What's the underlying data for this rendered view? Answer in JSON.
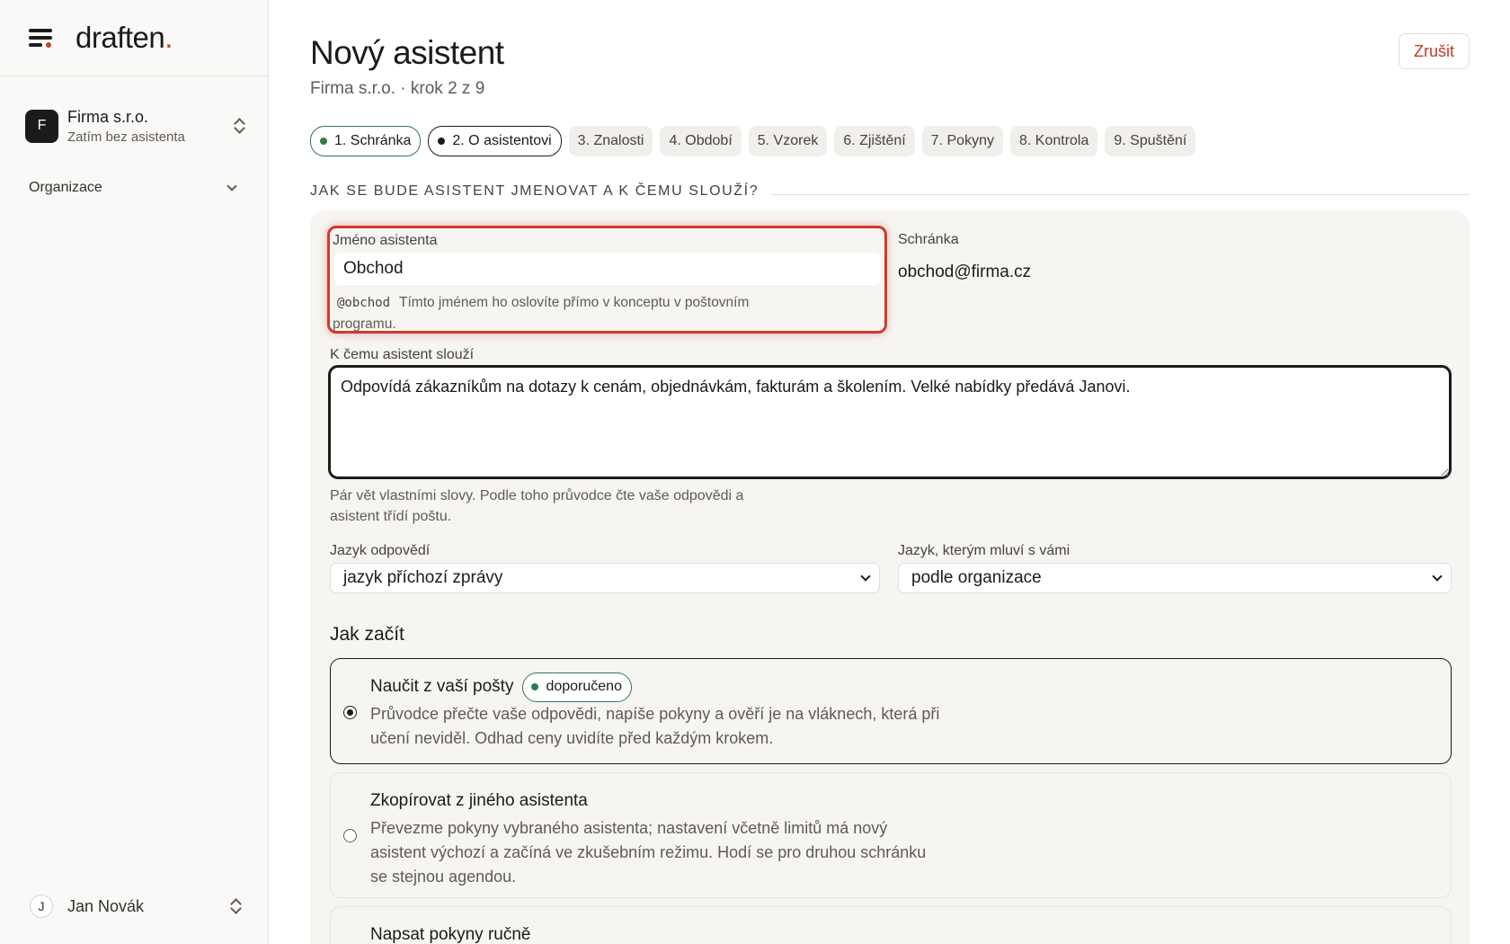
{
  "brand": {
    "name": "draften",
    "dot": "."
  },
  "org": {
    "avatar": "F",
    "name": "Firma s.r.o.",
    "status": "Zatím bez asistenta"
  },
  "sidebar": {
    "section": "Organizace"
  },
  "user": {
    "avatar": "J",
    "name": "Jan Novák"
  },
  "header": {
    "title": "Nový asistent",
    "subtitle": "Firma s.r.o. · krok 2 z 9",
    "cancel_label": "Zrušit"
  },
  "steps": [
    {
      "label": "1. Schránka",
      "state": "done"
    },
    {
      "label": "2. O asistentovi",
      "state": "current"
    },
    {
      "label": "3. Znalosti",
      "state": "todo"
    },
    {
      "label": "4. Období",
      "state": "todo"
    },
    {
      "label": "5. Vzorek",
      "state": "todo"
    },
    {
      "label": "6. Zjištění",
      "state": "todo"
    },
    {
      "label": "7. Pokyny",
      "state": "todo"
    },
    {
      "label": "8. Kontrola",
      "state": "todo"
    },
    {
      "label": "9. Spuštění",
      "state": "todo"
    }
  ],
  "section_title": "Jak se bude asistent jmenovat a k čemu slouží?",
  "form": {
    "name_label": "Jméno asistenta",
    "name_value": "Obchod",
    "handle": "@obchod",
    "name_hint": "Tímto jménem ho oslovíte přímo v konceptu v poštovním programu.",
    "mailbox_label": "Schránka",
    "mailbox_value": "obchod@firma.cz",
    "purpose_label": "K čemu asistent slouží",
    "purpose_value": "Odpovídá zákazníkům na dotazy k cenám, objednávkám, fakturám a školením. Velké nabídky předává Janovi.",
    "purpose_hint": "Pár vět vlastními slovy. Podle toho průvodce čte vaše odpovědi a asistent třídí poštu.",
    "reply_lang_label": "Jazyk odpovědí",
    "reply_lang_value": "jazyk příchozí zprávy",
    "ui_lang_label": "Jazyk, kterým mluví s vámi",
    "ui_lang_value": "podle organizace"
  },
  "start": {
    "title": "Jak začít",
    "options": [
      {
        "title": "Naučit z vaší pošty",
        "badge": "doporučeno",
        "desc": "Průvodce přečte vaše odpovědi, napíše pokyny a ověří je na vláknech, která při učení neviděl. Odhad ceny uvidíte před každým krokem.",
        "selected": true
      },
      {
        "title": "Zkopírovat z jiného asistenta",
        "desc": "Převezme pokyny vybraného asistenta; nastavení včetně limitů má nový asistent výchozí a začíná ve zkušebním režimu. Hodí se pro druhou schránku se stejnou agendou.",
        "selected": false
      },
      {
        "title": "Napsat pokyny ručně",
        "selected": false
      }
    ]
  },
  "colors": {
    "accent": "#d03a2c",
    "success": "#2f7a4f",
    "text": "#1c1b19"
  }
}
